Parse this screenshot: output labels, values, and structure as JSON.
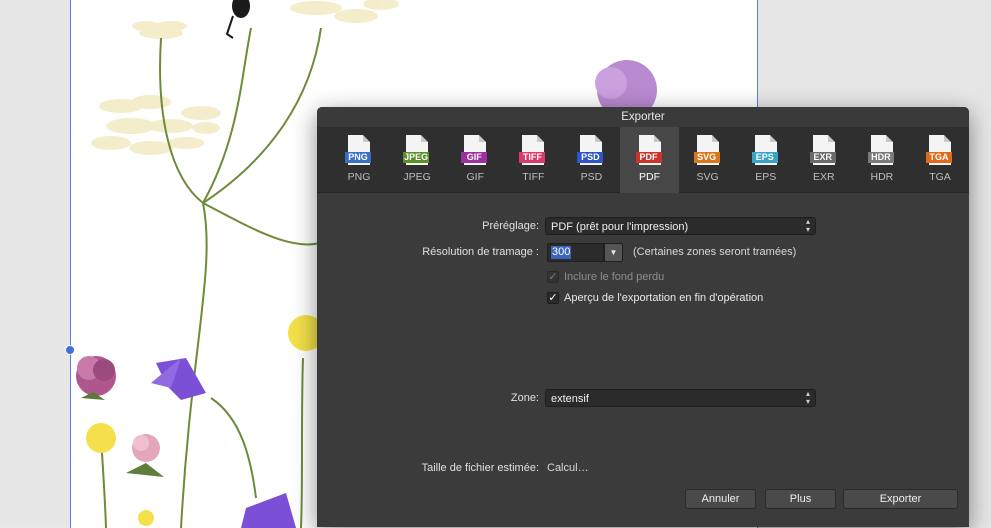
{
  "dialog": {
    "title": "Exporter",
    "formats": [
      {
        "label": "PNG",
        "badge": "PNG",
        "color": "#3b6fc7",
        "icon": "png-file-icon"
      },
      {
        "label": "JPEG",
        "badge": "JPEG",
        "color": "#5b8f2a",
        "icon": "jpeg-file-icon"
      },
      {
        "label": "GIF",
        "badge": "GIF",
        "color": "#9b2f9e",
        "icon": "gif-file-icon"
      },
      {
        "label": "TIFF",
        "badge": "TIFF",
        "color": "#d93a6a",
        "icon": "tiff-file-icon"
      },
      {
        "label": "PSD",
        "badge": "PSD",
        "color": "#2e56c9",
        "icon": "psd-file-icon"
      },
      {
        "label": "PDF",
        "badge": "PDF",
        "color": "#c9352a",
        "icon": "pdf-file-icon"
      },
      {
        "label": "SVG",
        "badge": "SVG",
        "color": "#d9771e",
        "icon": "svg-file-icon"
      },
      {
        "label": "EPS",
        "badge": "EPS",
        "color": "#3aa2c4",
        "icon": "eps-file-icon"
      },
      {
        "label": "EXR",
        "badge": "EXR",
        "color": "#6b6b6b",
        "icon": "exr-file-icon"
      },
      {
        "label": "HDR",
        "badge": "HDR",
        "color": "#7a7a7a",
        "icon": "hdr-file-icon"
      },
      {
        "label": "TGA",
        "badge": "TGA",
        "color": "#e06a1a",
        "icon": "tga-file-icon"
      }
    ],
    "selected_format": "PDF",
    "preset_label": "Préréglage:",
    "preset_value": "PDF (prêt pour l'impression)",
    "raster_label": "Résolution de tramage :",
    "raster_value": "300",
    "raster_note": "(Certaines zones seront tramées)",
    "bleed_label": "Inclure le fond perdu",
    "bleed_checked": true,
    "bleed_enabled": false,
    "preview_label": "Aperçu de l'exportation en fin d'opération",
    "preview_checked": true,
    "zone_label": "Zone:",
    "zone_value": "extensif",
    "filesize_label": "Taille de fichier estimée:",
    "filesize_value": "Calcul…",
    "cancel_label": "Annuler",
    "more_label": "Plus",
    "export_label": "Exporter",
    "check_glyph": "✓"
  }
}
